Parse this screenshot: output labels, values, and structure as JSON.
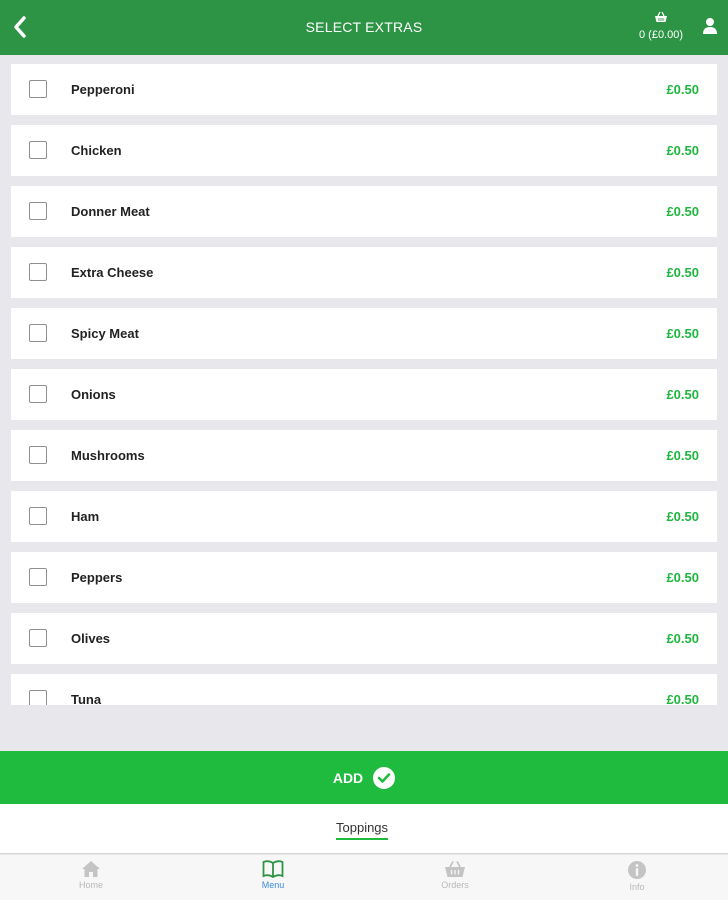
{
  "header": {
    "title": "SELECT EXTRAS",
    "basket_count": "0 (£0.00)"
  },
  "extras": [
    {
      "name": "Pepperoni",
      "price": "£0.50",
      "checked": false
    },
    {
      "name": "Chicken",
      "price": "£0.50",
      "checked": false
    },
    {
      "name": "Donner Meat",
      "price": "£0.50",
      "checked": false
    },
    {
      "name": "Extra Cheese",
      "price": "£0.50",
      "checked": false
    },
    {
      "name": "Spicy Meat",
      "price": "£0.50",
      "checked": false
    },
    {
      "name": "Onions",
      "price": "£0.50",
      "checked": false
    },
    {
      "name": "Mushrooms",
      "price": "£0.50",
      "checked": false
    },
    {
      "name": "Ham",
      "price": "£0.50",
      "checked": false
    },
    {
      "name": "Peppers",
      "price": "£0.50",
      "checked": false
    },
    {
      "name": "Olives",
      "price": "£0.50",
      "checked": false
    },
    {
      "name": "Tuna",
      "price": "£0.50",
      "checked": false
    }
  ],
  "add_button": {
    "label": "ADD"
  },
  "category": {
    "active_tab": "Toppings"
  },
  "nav": [
    {
      "label": "Home",
      "icon": "home-icon",
      "active": false
    },
    {
      "label": "Menu",
      "icon": "menu-book-icon",
      "active": true
    },
    {
      "label": "Orders",
      "icon": "basket-icon",
      "active": false
    },
    {
      "label": "Info",
      "icon": "info-icon",
      "active": false
    }
  ],
  "colors": {
    "header": "#2e9445",
    "accent": "#1fbb3e",
    "price": "#1fb53e",
    "nav_active": "#3b8de0",
    "nav_inactive": "#b8b8b8"
  }
}
